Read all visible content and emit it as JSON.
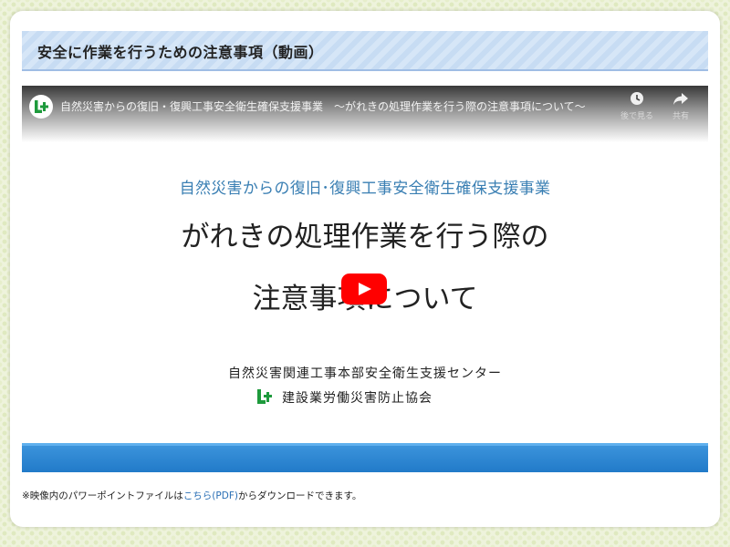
{
  "section": {
    "title": "安全に作業を行うための注意事項（動画）"
  },
  "video": {
    "title": "自然災害からの復旧・復興工事安全衛生確保支援事業　～がれきの処理作業を行う際の注意事項について～",
    "controls": {
      "later_label": "後で見る",
      "share_label": "共有"
    },
    "channel_icon": "organization-logo-icon",
    "slide": {
      "subtitle": "自然災害からの復旧･復興工事安全衛生確保支援事業",
      "heading_line1": "がれきの処理作業を行う際の",
      "heading_line2": "注意事項について",
      "department": "自然災害関連工事本部安全衛生支援センター",
      "organization": "建設業労働災害防止協会"
    },
    "play_icon": "youtube-play-icon",
    "colors": {
      "play_button": "#ff0000",
      "subtitle": "#3a7fb3",
      "bottom_bar": "#1f78c7",
      "logo_green": "#1e9a3c"
    }
  },
  "note": {
    "prefix": "※映像内のパワーポイントファイルは",
    "link": "こちら(PDF)",
    "suffix": "からダウンロードできます。"
  }
}
